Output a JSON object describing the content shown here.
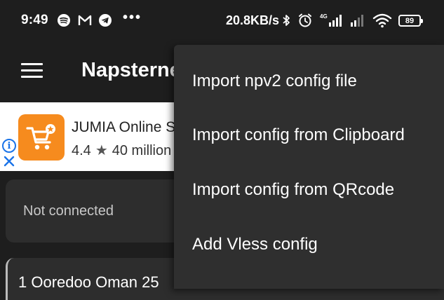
{
  "status_bar": {
    "time": "9:49",
    "notification_icons": [
      "spotify-icon",
      "gmail-icon",
      "telegram-icon"
    ],
    "more": "•••",
    "net_speed": "20.8KB/s",
    "network_type": "4G",
    "battery": "89"
  },
  "app_bar": {
    "title": "Napsternet"
  },
  "ad": {
    "title": "JUMIA Online Shopping",
    "rating": "4.4",
    "downloads": "40 million",
    "brand_color": "#f68b1e"
  },
  "connection": {
    "status": "Not connected"
  },
  "server_list": {
    "first_item": "1 Ooredoo Oman 25"
  },
  "popup_menu": {
    "items": [
      "Import npv2 config file",
      "Import config from Clipboard",
      "Import config from QRcode",
      "Add Vless config"
    ]
  }
}
